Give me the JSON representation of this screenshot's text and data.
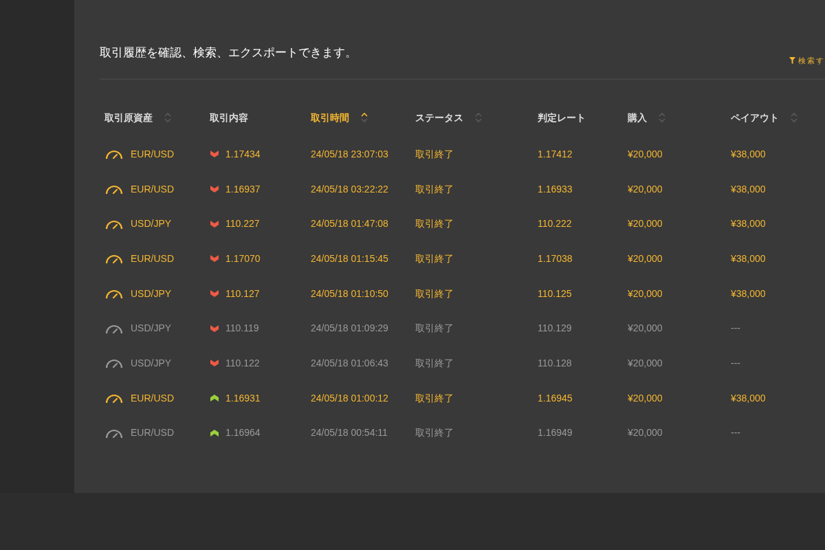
{
  "description": "取引履歴を確認、検索、エクスポートできます。",
  "filter_link": {
    "label": "検索す"
  },
  "table": {
    "columns": [
      {
        "label": "取引原資産",
        "sortable": true,
        "active": false
      },
      {
        "label": "取引内容",
        "sortable": false,
        "active": false
      },
      {
        "label": "取引時間",
        "sortable": true,
        "active": true
      },
      {
        "label": "ステータス",
        "sortable": true,
        "active": false
      },
      {
        "label": "判定レート",
        "sortable": false,
        "active": false
      },
      {
        "label": "購入",
        "sortable": true,
        "active": false
      },
      {
        "label": "ペイアウト",
        "sortable": true,
        "active": false
      }
    ],
    "rows": [
      {
        "won": true,
        "asset": "EUR/USD",
        "falling": true,
        "rate": "1.17434",
        "time": "24/05/18 23:07:03",
        "status": "取引終了",
        "result_rate": "1.17412",
        "purchase": "¥20,000",
        "payout": "¥38,000"
      },
      {
        "won": true,
        "asset": "EUR/USD",
        "falling": true,
        "rate": "1.16937",
        "time": "24/05/18 03:22:22",
        "status": "取引終了",
        "result_rate": "1.16933",
        "purchase": "¥20,000",
        "payout": "¥38,000"
      },
      {
        "won": true,
        "asset": "USD/JPY",
        "falling": true,
        "rate": "110.227",
        "time": "24/05/18 01:47:08",
        "status": "取引終了",
        "result_rate": "110.222",
        "purchase": "¥20,000",
        "payout": "¥38,000"
      },
      {
        "won": true,
        "asset": "EUR/USD",
        "falling": true,
        "rate": "1.17070",
        "time": "24/05/18 01:15:45",
        "status": "取引終了",
        "result_rate": "1.17038",
        "purchase": "¥20,000",
        "payout": "¥38,000"
      },
      {
        "won": true,
        "asset": "USD/JPY",
        "falling": true,
        "rate": "110.127",
        "time": "24/05/18 01:10:50",
        "status": "取引終了",
        "result_rate": "110.125",
        "purchase": "¥20,000",
        "payout": "¥38,000"
      },
      {
        "won": false,
        "asset": "USD/JPY",
        "falling": true,
        "rate": "110.119",
        "time": "24/05/18 01:09:29",
        "status": "取引終了",
        "result_rate": "110.129",
        "purchase": "¥20,000",
        "payout": "---"
      },
      {
        "won": false,
        "asset": "USD/JPY",
        "falling": true,
        "rate": "110.122",
        "time": "24/05/18 01:06:43",
        "status": "取引終了",
        "result_rate": "110.128",
        "purchase": "¥20,000",
        "payout": "---"
      },
      {
        "won": true,
        "asset": "EUR/USD",
        "falling": false,
        "rate": "1.16931",
        "time": "24/05/18 01:00:12",
        "status": "取引終了",
        "result_rate": "1.16945",
        "purchase": "¥20,000",
        "payout": "¥38,000"
      },
      {
        "won": false,
        "asset": "EUR/USD",
        "falling": false,
        "rate": "1.16964",
        "time": "24/05/18 00:54:11",
        "status": "取引終了",
        "result_rate": "1.16949",
        "purchase": "¥20,000",
        "payout": "---"
      }
    ]
  }
}
